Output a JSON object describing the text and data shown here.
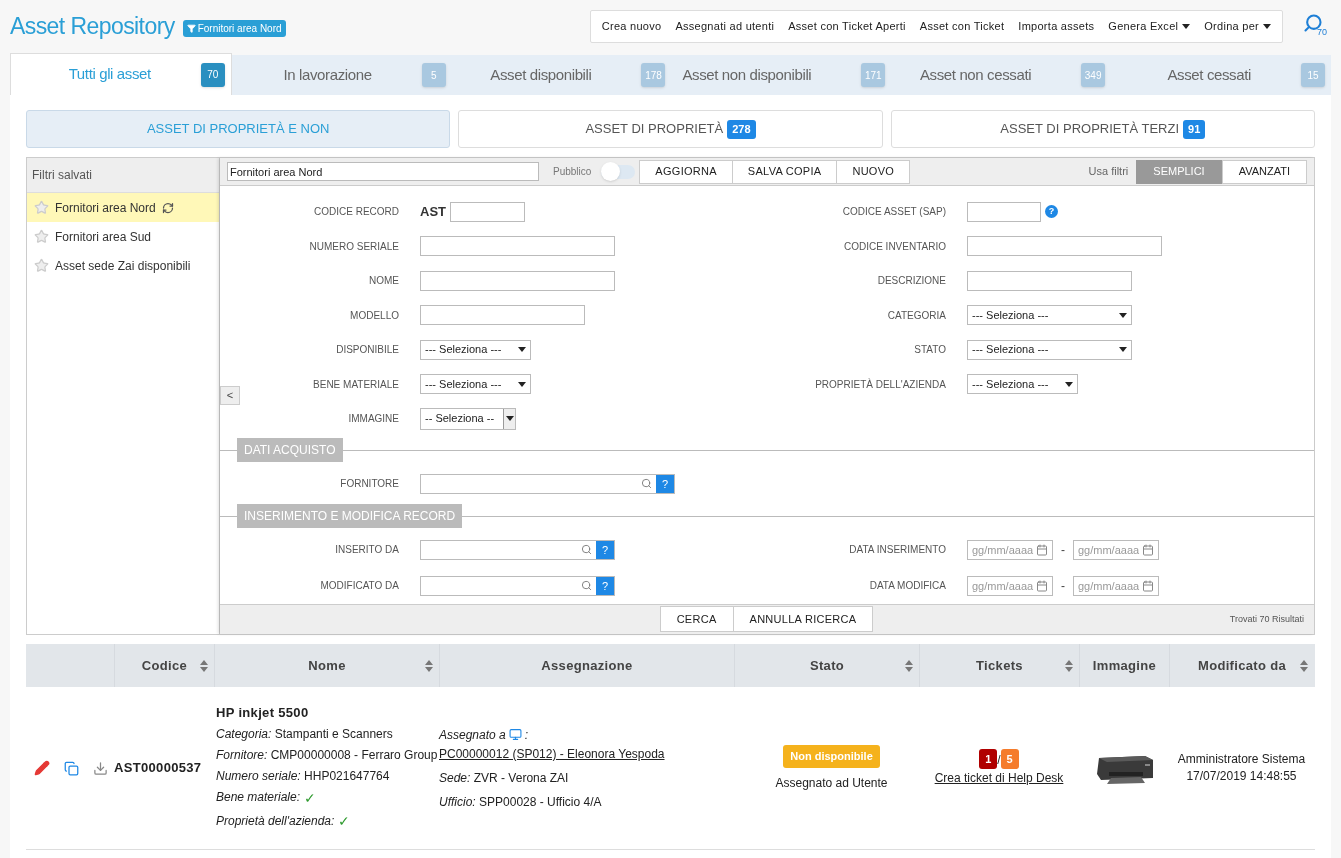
{
  "header": {
    "title": "Asset Repository",
    "filter_badge": "Fornitori area Nord",
    "search_count": "70"
  },
  "toolbar": [
    {
      "label": "Crea nuovo",
      "dropdown": false
    },
    {
      "label": "Assegnati ad utenti",
      "dropdown": false
    },
    {
      "label": "Asset con Ticket Aperti",
      "dropdown": false
    },
    {
      "label": "Asset con Ticket",
      "dropdown": false
    },
    {
      "label": "Importa assets",
      "dropdown": false
    },
    {
      "label": "Genera Excel",
      "dropdown": true
    },
    {
      "label": "Ordina per",
      "dropdown": true
    }
  ],
  "tabs": [
    {
      "label": "Tutti gli asset",
      "count": "70",
      "selected": true
    },
    {
      "label": "In lavorazione",
      "count": "5",
      "selected": false
    },
    {
      "label": "Asset disponibili",
      "count": "178",
      "selected": false
    },
    {
      "label": "Asset non disponibili",
      "count": "171",
      "selected": false
    },
    {
      "label": "Asset non cessati",
      "count": "349",
      "selected": false
    },
    {
      "label": "Asset cessati",
      "count": "15",
      "selected": false
    }
  ],
  "ownership": [
    {
      "label": "ASSET DI PROPRIETÀ E NON",
      "selected": true
    },
    {
      "label": "ASSET DI PROPRIETÀ",
      "count": "278",
      "selected": false
    },
    {
      "label": "ASSET DI PROPRIETÀ TERZI",
      "count": "91",
      "selected": false
    }
  ],
  "collapse_button": "<",
  "saved_filters": {
    "title": "Filtri salvati",
    "items": [
      {
        "label": "Fornitori area Nord",
        "selected": true
      },
      {
        "label": "Fornitori area Sud",
        "selected": false
      },
      {
        "label": "Asset sede Zai disponibili",
        "selected": false
      }
    ]
  },
  "filter_bar": {
    "name": "Fornitori area Nord",
    "public_label": "Pubblico",
    "public_on": false,
    "buttons": [
      "AGGIORNA",
      "SALVA COPIA",
      "NUOVO"
    ],
    "mode_label": "Usa filtri",
    "modes": [
      {
        "label": "SEMPLICI",
        "selected": true
      },
      {
        "label": "AVANZATI",
        "selected": false
      }
    ]
  },
  "sections": [
    {
      "rows": [
        {
          "left": {
            "label": "CODICE RECORD",
            "kind": "code",
            "prefix": "AST"
          },
          "right": {
            "label": "CODICE ASSET (SAP)",
            "kind": "short",
            "help": "?"
          }
        },
        {
          "left": {
            "label": "NUMERO SERIALE",
            "kind": "text"
          },
          "right": {
            "label": "CODICE INVENTARIO",
            "kind": "text"
          }
        },
        {
          "left": {
            "label": "NOME",
            "kind": "text"
          },
          "right": {
            "label": "DESCRIZIONE",
            "kind": "medium"
          }
        },
        {
          "left": {
            "label": "MODELLO",
            "kind": "medium"
          },
          "right": {
            "label": "CATEGORIA",
            "kind": "select",
            "value": "--- Seleziona ---"
          }
        },
        {
          "left": {
            "label": "DISPONIBILE",
            "kind": "select_small",
            "value": "--- Seleziona ---"
          },
          "right": {
            "label": "STATO",
            "kind": "select",
            "value": "--- Seleziona ---"
          }
        },
        {
          "left": {
            "label": "BENE MATERIALE",
            "kind": "select_small",
            "value": "--- Seleziona ---"
          },
          "right": {
            "label": "PROPRIETÀ DELL'AZIENDA",
            "kind": "select_small",
            "value": "--- Seleziona ---"
          }
        },
        {
          "left": {
            "label": "IMMAGINE",
            "kind": "select_button",
            "value": "-- Seleziona --"
          }
        }
      ]
    },
    {
      "title": "DATI ACQUISTO",
      "rows": [
        {
          "left": {
            "label": "FORNITORE",
            "kind": "lookup_wide",
            "help": "?"
          }
        }
      ]
    },
    {
      "title": "INSERIMENTO E MODIFICA RECORD",
      "rows": [
        {
          "left": {
            "label": "INSERITO DA",
            "kind": "lookup",
            "help": "?"
          },
          "right": {
            "label": "DATA INSERIMENTO",
            "kind": "date_range",
            "from": "gg/mm/aaaa",
            "separator": "-",
            "to": "gg/mm/aaaa"
          }
        },
        {
          "left": {
            "label": "MODIFICATO DA",
            "kind": "lookup",
            "help": "?"
          },
          "right": {
            "label": "DATA MODIFICA",
            "kind": "date_range",
            "from": "gg/mm/aaaa",
            "separator": "-",
            "to": "gg/mm/aaaa"
          }
        }
      ]
    }
  ],
  "actions": [
    "CERCA",
    "ANNULLA RICERCA"
  ],
  "results": "Trovati 70 Risultati",
  "table": {
    "columns": [
      {
        "label": "Codice",
        "sortable": true
      },
      {
        "label": "Nome",
        "sortable": true
      },
      {
        "label": "Assegnazione",
        "sortable": false
      },
      {
        "label": "Stato",
        "sortable": true
      },
      {
        "label": "Tickets",
        "sortable": true
      },
      {
        "label": "Immagine",
        "sortable": false
      },
      {
        "label": "Modificato da",
        "sortable": true
      }
    ],
    "rows": [
      {
        "code": "AST00000537",
        "name": "HP inkjet 5500",
        "details": [
          {
            "label": "Categoria:",
            "value": "Stampanti e Scanners"
          },
          {
            "label": "Fornitore:",
            "value": "CMP00000008 - Ferraro Group"
          },
          {
            "label": "Numero seriale:",
            "value": "HHP021647764"
          }
        ],
        "flags": [
          {
            "label": "Bene materiale:",
            "mark": "✓"
          },
          {
            "label": "Proprietà dell'azienda:",
            "mark": "✓"
          }
        ],
        "assignment": {
          "label": "Assegnato a",
          "colon": ":",
          "link": "PC00000012 (SP012) - Eleonora Yespoda",
          "lines": [
            {
              "label": "Sede:",
              "value": "ZVR - Verona ZAI"
            },
            {
              "label": "Ufficio:",
              "value": "SPP00028 - Ufficio 4/A"
            }
          ]
        },
        "status": {
          "badge": "Non disponibile",
          "color": "#f5b21c",
          "note": "Assegnato ad Utente"
        },
        "tickets": {
          "open": "1",
          "separator": "/",
          "total": "5",
          "link": "Crea ticket di Help Desk"
        },
        "image": {
          "kind": "picture"
        },
        "modified_by": "Amministratore Sistema",
        "modified_at": "17/07/2019 14:48:55"
      }
    ]
  }
}
